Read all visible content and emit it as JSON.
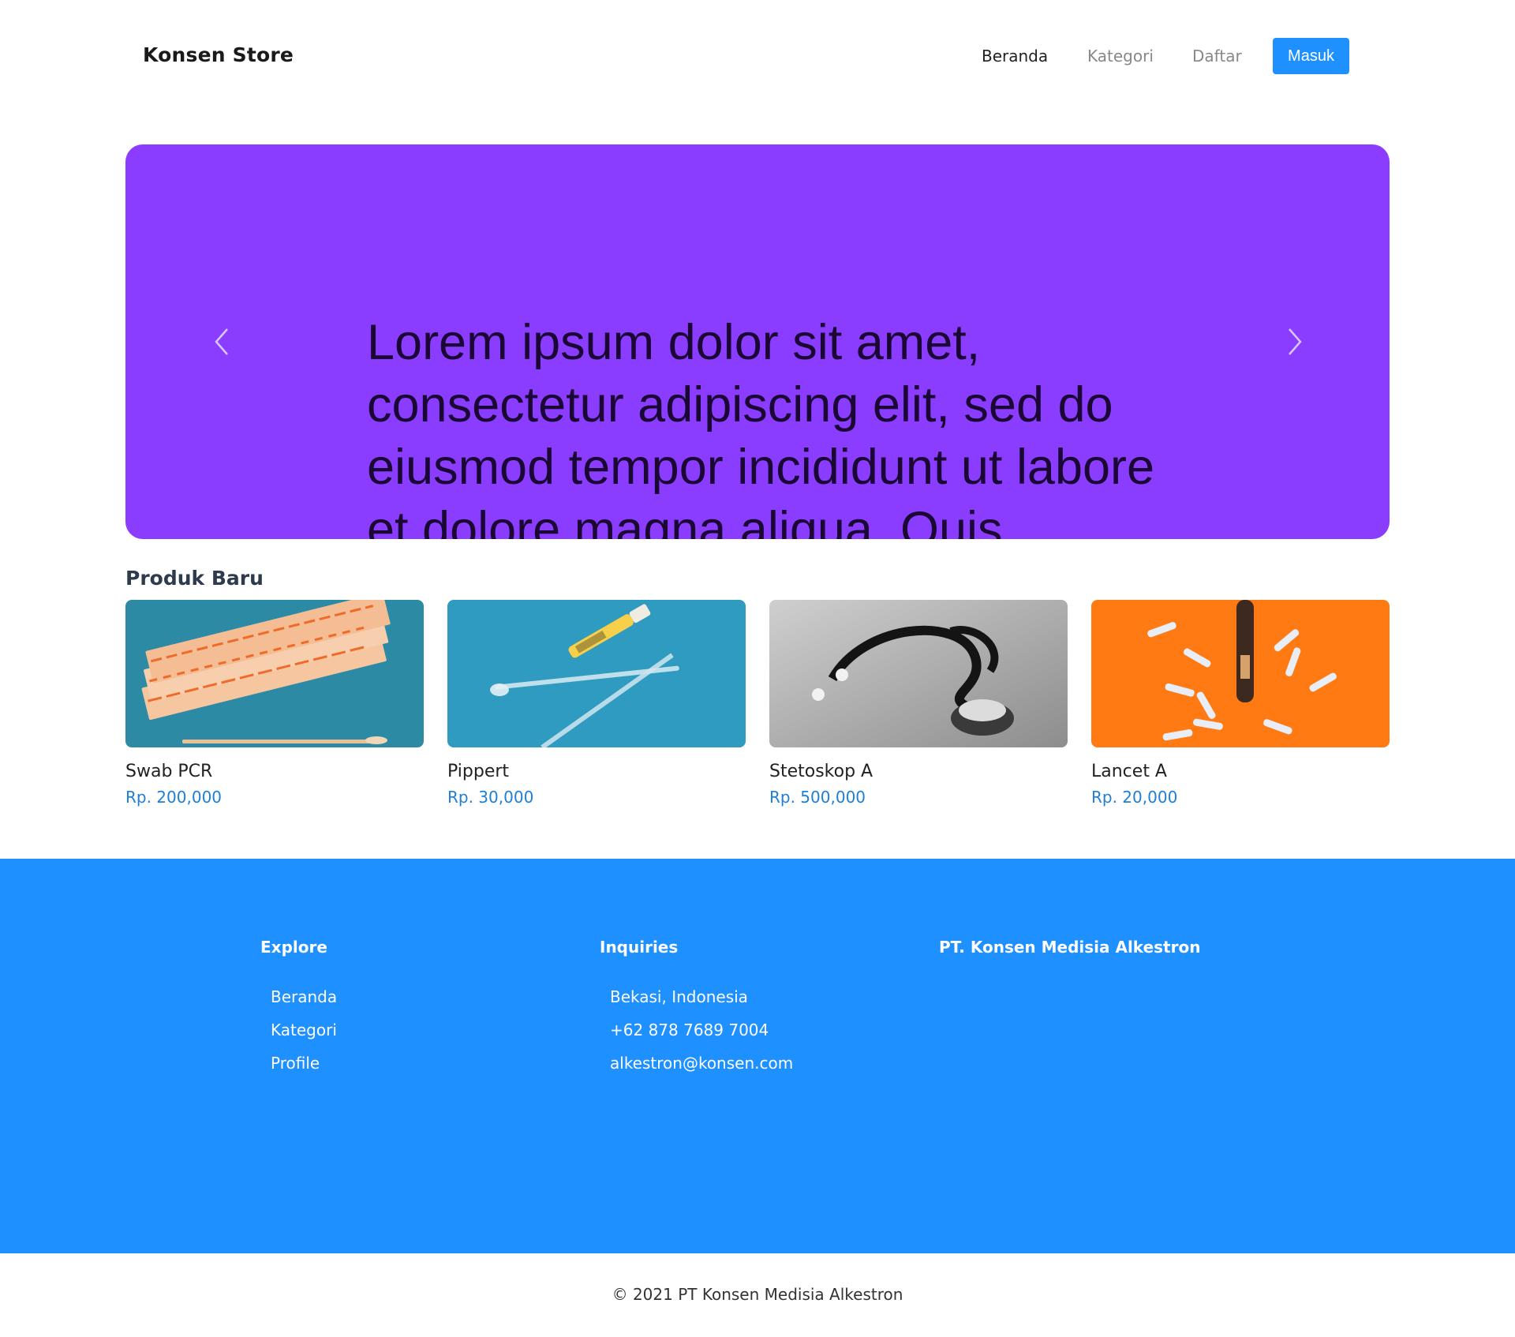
{
  "navbar": {
    "brand": "Konsen Store",
    "links": [
      "Beranda",
      "Kategori",
      "Daftar"
    ],
    "login_button": "Masuk"
  },
  "hero": {
    "text": "Lorem ipsum dolor sit amet, consectetur adipiscing elit, sed do eiusmod tempor incididunt ut labore et dolore magna aliqua. Quis",
    "background": "#8a3cff",
    "prev_icon": "chevron-left-icon",
    "next_icon": "chevron-right-icon"
  },
  "products": {
    "title": "Produk Baru",
    "items": [
      {
        "name": "Swab PCR",
        "price": "Rp. 200,000"
      },
      {
        "name": "Pippert",
        "price": "Rp. 30,000"
      },
      {
        "name": "Stetoskop A",
        "price": "Rp. 500,000"
      },
      {
        "name": "Lancet A",
        "price": "Rp. 20,000"
      }
    ]
  },
  "footer": {
    "explore": {
      "title": "Explore",
      "items": [
        "Beranda",
        "Kategori",
        "Profile"
      ]
    },
    "inquiries": {
      "title": "Inquiries",
      "items": [
        "Bekasi, Indonesia",
        "+62 878 7689 7004",
        "alkestron@konsen.com"
      ]
    },
    "company": {
      "title": "PT. Konsen Medisia Alkestron"
    },
    "background": "#1e90ff"
  },
  "copyright": "© 2021 PT Konsen Medisia Alkestron"
}
